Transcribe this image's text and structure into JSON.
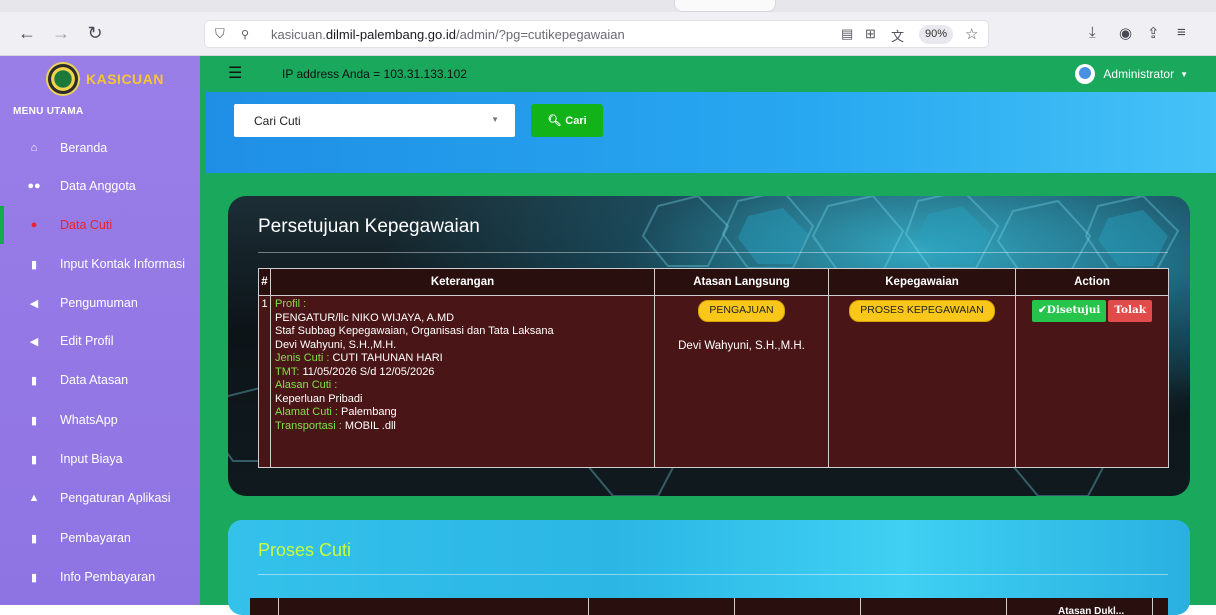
{
  "browser": {
    "url_prefix": "kasicuan.",
    "url_domain": "dilmil-palembang.go.id",
    "url_path": "/admin/?pg=cutikepegawaian",
    "zoom": "90%"
  },
  "sidebar": {
    "brand": "KASICUAN",
    "menu_title": "MENU UTAMA",
    "items": [
      {
        "label": "Beranda",
        "icon": "home-icon"
      },
      {
        "label": "Data Anggota",
        "icon": "users-icon"
      },
      {
        "label": "Data Cuti",
        "icon": "user-icon",
        "active": true
      },
      {
        "label": "Input Kontak Informasi",
        "icon": "card-icon"
      },
      {
        "label": "Pengumuman",
        "icon": "megaphone-icon"
      },
      {
        "label": "Edit Profil",
        "icon": "megaphone-icon"
      },
      {
        "label": "Data Atasan",
        "icon": "card-icon"
      },
      {
        "label": "WhatsApp",
        "icon": "card-icon"
      },
      {
        "label": "Input Biaya",
        "icon": "card-icon"
      },
      {
        "label": "Pengaturan Aplikasi",
        "icon": "bank-icon"
      },
      {
        "label": "Pembayaran",
        "icon": "card-icon"
      },
      {
        "label": "Info Pembayaran",
        "icon": "card-icon"
      }
    ]
  },
  "topbar": {
    "ip_text": "IP address Anda = 103.31.133.102",
    "user": "Administrator"
  },
  "search": {
    "select_value": "Cari Cuti",
    "button": "Cari"
  },
  "approval": {
    "title": "Persetujuan Kepegawaian",
    "headers": [
      "#",
      "Keterangan",
      "Atasan Langsung",
      "Kepegawaian",
      "Action"
    ],
    "row": {
      "no": "1",
      "profil_label": "Profil :",
      "profil_name": "PENGATUR/llc NIKO WIJAYA, A.MD",
      "jabatan": "Staf Subbag Kepegawaian, Organisasi dan Tata Laksana",
      "atasan": "Devi Wahyuni, S.H.,M.H.",
      "jenis_label": "Jenis Cuti :",
      "jenis_value": " CUTI TAHUNAN  HARI",
      "tmt_label": "TMT:",
      "tmt_value": " 11/05/2026 S/d  12/05/2026",
      "alasan_label": "Alasan Cuti :",
      "alasan_value": "Keperluan Pribadi",
      "alamat_label": "Alamat Cuti :",
      "alamat_value": " Palembang",
      "transport_label": "Transportasi :",
      "transport_value": " MOBIL .dll",
      "atasan_badge": "PENGAJUAN",
      "atasan_name": "Devi Wahyuni, S.H.,M.H.",
      "kepeg_badge": "PROSES KEPEGAWAIAN",
      "btn_approve": "Disetujui",
      "btn_reject": "Tolak"
    }
  },
  "process": {
    "title": "Proses Cuti",
    "partial_header": "Atasan Dukl..."
  }
}
